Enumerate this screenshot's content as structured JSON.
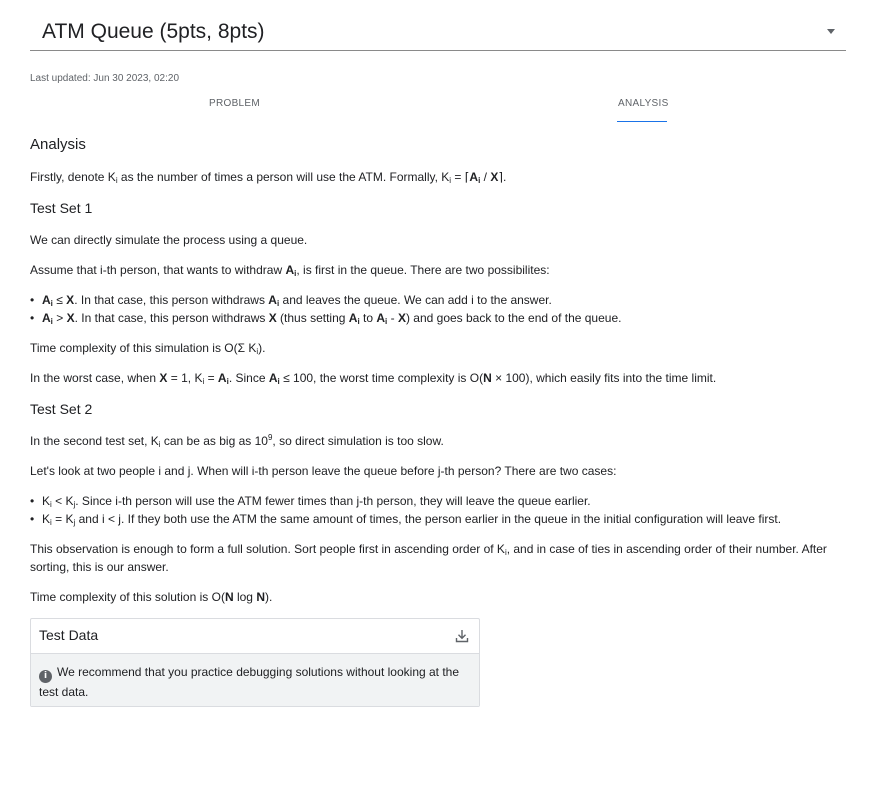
{
  "header": {
    "title": "ATM Queue (5pts, 8pts)",
    "dropdown_icon": "arrow-drop-down-icon"
  },
  "meta": {
    "last_updated": "Last updated: Jun 30 2023, 02:20"
  },
  "tabs": [
    {
      "label": "PROBLEM",
      "active": false
    },
    {
      "label": "ANALYSIS",
      "active": true
    }
  ],
  "colors": {
    "accent": "#1a73e8",
    "text": "#202124",
    "muted": "#5f6368"
  },
  "analysis": {
    "heading": "Analysis",
    "intro": {
      "a": "Firstly, denote K",
      "b": "i",
      "c": " as the number of times a person will use the ATM. Formally, K",
      "d": "i",
      "e": " = ⌈",
      "f": "A",
      "g": "i",
      "h": " / ",
      "i": "X",
      "j": "⌉."
    },
    "ts1": {
      "heading": "Test Set 1",
      "p1": "We can directly simulate the process using a queue.",
      "p2": {
        "a": "Assume that i-th person, that wants to withdraw ",
        "b": "A",
        "c": "i",
        "d": ", is first in the queue. There are two possibilites:"
      },
      "b1": {
        "a": "A",
        "b": "i",
        "c": " ≤ ",
        "d": "X",
        "e": ". In that case, this person withdraws ",
        "f": "A",
        "g": "i",
        "h": " and leaves the queue. We can add i to the answer."
      },
      "b2": {
        "a": "A",
        "b": "i",
        "c": " > ",
        "d": "X",
        "e": ". In that case, this person withdraws ",
        "f": "X",
        "g": " (thus setting ",
        "h": "A",
        "i": "i",
        "j": " to ",
        "k": "A",
        "l": "i",
        "m": " - ",
        "n": "X",
        "o": ") and goes back to the end of the queue."
      },
      "p3": {
        "a": "Time complexity of this simulation is O(Σ K",
        "b": "i",
        "c": ")."
      },
      "p4": {
        "a": "In the worst case, when ",
        "b": "X",
        "c": " = 1, K",
        "d": "i",
        "e": " = ",
        "f": "A",
        "g": "i",
        "h": ". Since ",
        "i": "A",
        "j": "i",
        "k": " ≤ 100, the worst time complexity is O(",
        "l": "N",
        "m": " × 100), which easily fits into the time limit."
      }
    },
    "ts2": {
      "heading": "Test Set 2",
      "p1": {
        "a": "In the second test set, K",
        "b": "i",
        "c": " can be as big as 10",
        "d": "9",
        "e": ", so direct simulation is too slow."
      },
      "p2": "Let's look at two people i and j. When will i-th person leave the queue before j-th person? There are two cases:",
      "b1": {
        "a": "K",
        "b": "i",
        "c": " < K",
        "d": "j",
        "e": ". Since i-th person will use the ATM fewer times than j-th person, they will leave the queue earlier."
      },
      "b2": {
        "a": "K",
        "b": "i",
        "c": " = K",
        "d": "j",
        "e": " and i < j. If they both use the ATM the same amount of times, the person earlier in the queue in the initial configuration will leave first."
      },
      "p3": {
        "a": "This observation is enough to form a full solution. Sort people first in ascending order of K",
        "b": "i",
        "c": ", and in case of ties in ascending order of their number. After sorting, this is our answer."
      },
      "p4": {
        "a": "Time complexity of this solution is O(",
        "b": "N",
        "c": " log ",
        "d": "N",
        "e": ")."
      }
    }
  },
  "test_data": {
    "title": "Test Data",
    "download_icon": "download-icon",
    "info_icon": "info-icon",
    "info_glyph": "i",
    "note": "We recommend that you practice debugging solutions without looking at the test data."
  }
}
